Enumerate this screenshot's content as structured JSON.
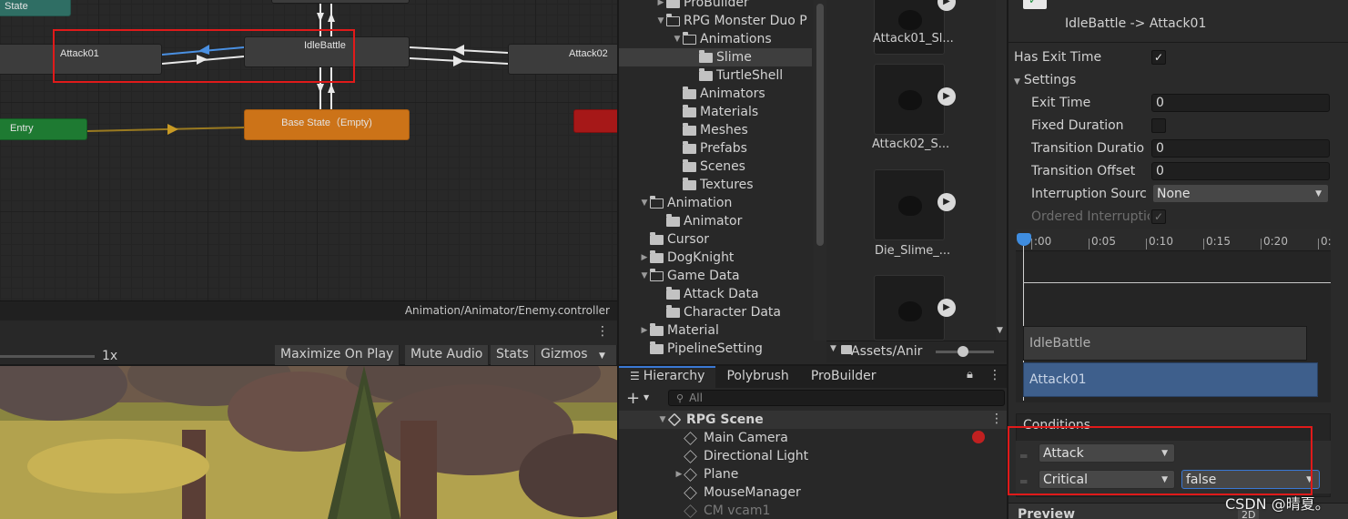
{
  "animator": {
    "nodes": {
      "state_partial": "State",
      "attack01": "Attack01",
      "idle_battle": "IdleBattle",
      "attack02": "Attack02",
      "entry": "Entry",
      "base_state": "Base State（Empty)",
      "probuilder_partial": "ProBuilder"
    },
    "path": "Animation/Animator/Enemy.controller"
  },
  "game": {
    "scale_label": "1x",
    "buttons": [
      "Maximize On Play",
      "Mute Audio",
      "Stats",
      "Gizmos"
    ]
  },
  "project": {
    "tree": [
      {
        "label": "ProBuilder",
        "indent": 1,
        "arrow": "right",
        "open": false,
        "selected": false
      },
      {
        "label": "RPG Monster Duo P",
        "indent": 1,
        "arrow": "down",
        "open": true,
        "selected": false
      },
      {
        "label": "Animations",
        "indent": 2,
        "arrow": "down",
        "open": true,
        "selected": false
      },
      {
        "label": "Slime",
        "indent": 3,
        "arrow": "",
        "open": false,
        "selected": true
      },
      {
        "label": "TurtleShell",
        "indent": 3,
        "arrow": "",
        "open": false,
        "selected": false
      },
      {
        "label": "Animators",
        "indent": 2,
        "arrow": "",
        "open": false,
        "selected": false
      },
      {
        "label": "Materials",
        "indent": 2,
        "arrow": "",
        "open": false,
        "selected": false
      },
      {
        "label": "Meshes",
        "indent": 2,
        "arrow": "",
        "open": false,
        "selected": false
      },
      {
        "label": "Prefabs",
        "indent": 2,
        "arrow": "",
        "open": false,
        "selected": false
      },
      {
        "label": "Scenes",
        "indent": 2,
        "arrow": "",
        "open": false,
        "selected": false
      },
      {
        "label": "Textures",
        "indent": 2,
        "arrow": "",
        "open": false,
        "selected": false
      },
      {
        "label": "Animation",
        "indent": 0,
        "arrow": "down",
        "open": true,
        "selected": false
      },
      {
        "label": "Animator",
        "indent": 1,
        "arrow": "",
        "open": false,
        "selected": false
      },
      {
        "label": "Cursor",
        "indent": 0,
        "arrow": "",
        "open": false,
        "selected": false
      },
      {
        "label": "DogKnight",
        "indent": 0,
        "arrow": "right",
        "open": false,
        "selected": false
      },
      {
        "label": "Game Data",
        "indent": 0,
        "arrow": "down",
        "open": true,
        "selected": false
      },
      {
        "label": "Attack Data",
        "indent": 1,
        "arrow": "",
        "open": false,
        "selected": false
      },
      {
        "label": "Character Data",
        "indent": 1,
        "arrow": "",
        "open": false,
        "selected": false
      },
      {
        "label": "Material",
        "indent": 0,
        "arrow": "right",
        "open": false,
        "selected": false
      },
      {
        "label": "PipelineSetting",
        "indent": 0,
        "arrow": "",
        "open": false,
        "selected": false
      }
    ],
    "assets": [
      "Attack01_Sl...",
      "Attack02_S...",
      "Die_Slime_...",
      ""
    ],
    "breadcrumb": "Assets/Anir"
  },
  "hierarchy": {
    "tabs": [
      "Hierarchy",
      "Polybrush",
      "ProBuilder"
    ],
    "search_placeholder": "All",
    "scene": "RPG Scene",
    "items": [
      {
        "label": "Main Camera",
        "arrow": false,
        "dim": false
      },
      {
        "label": "Directional Light",
        "arrow": false,
        "dim": false
      },
      {
        "label": "Plane",
        "arrow": true,
        "dim": false
      },
      {
        "label": "MouseManager",
        "arrow": false,
        "dim": false
      },
      {
        "label": "CM vcam1",
        "arrow": false,
        "dim": true
      }
    ]
  },
  "inspector": {
    "transition_title": "IdleBattle -> Attack01",
    "has_exit_time_label": "Has Exit Time",
    "has_exit_time": "✓",
    "settings_label": "Settings",
    "exit_time_label": "Exit Time",
    "exit_time": "0",
    "fixed_duration_label": "Fixed Duration",
    "transition_duration_label": "Transition Duratio",
    "transition_duration": "0",
    "transition_offset_label": "Transition Offset",
    "transition_offset": "0",
    "interruption_source_label": "Interruption Sourc",
    "interruption_source": "None",
    "ordered_interruption_label": "Ordered Interruptic",
    "ordered_interruption": "✓",
    "timeline_ticks": [
      ":00",
      "0:05",
      "0:10",
      "0:15",
      "0:20",
      "0:"
    ],
    "timeline_bars": [
      "IdleBattle",
      "Attack01"
    ],
    "conditions_label": "Conditions",
    "conditions": [
      {
        "param": "Attack",
        "value": ""
      },
      {
        "param": "Critical",
        "value": "false"
      }
    ],
    "preview_label": "Preview",
    "preview_2d": "2D"
  },
  "watermark": "CSDN @晴夏。"
}
